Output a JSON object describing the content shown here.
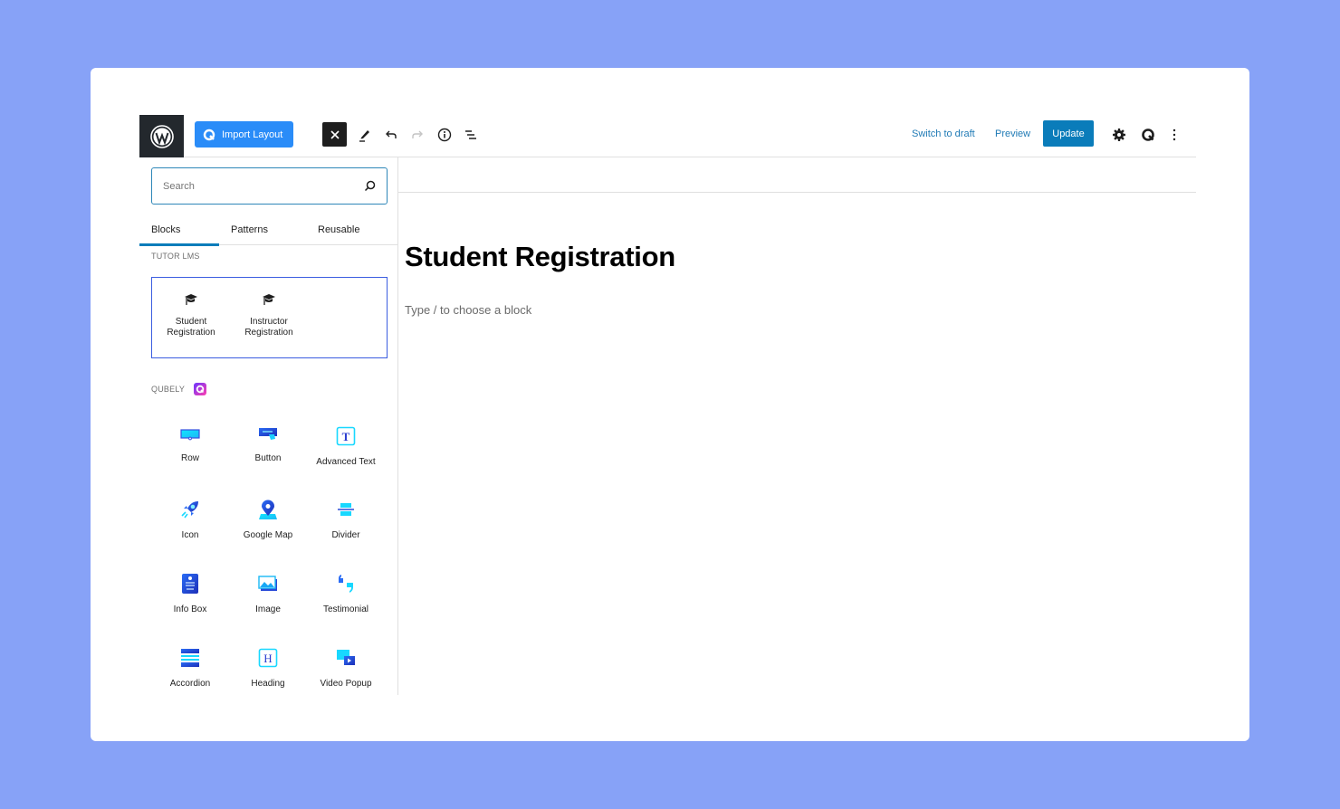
{
  "toolbar": {
    "import_layout_label": "Import Layout",
    "switch_to_draft_label": "Switch to draft",
    "preview_label": "Preview",
    "update_label": "Update",
    "icons": [
      "wordpress-logo",
      "close-icon",
      "pencil-icon",
      "undo-icon",
      "redo-icon",
      "info-icon",
      "list-view-icon",
      "gear-icon",
      "qubely-icon",
      "more-vertical-icon"
    ]
  },
  "sidebar": {
    "search": {
      "placeholder": "Search",
      "value": ""
    },
    "tabs": [
      {
        "label": "Blocks",
        "active": true
      },
      {
        "label": "Patterns",
        "active": false
      },
      {
        "label": "Reusable",
        "active": false
      }
    ],
    "sections": [
      {
        "label": "TUTOR LMS",
        "blocks": [
          {
            "line1": "Student",
            "line2": "Registration",
            "icon": "graduation-cap-icon"
          },
          {
            "line1": "Instructor",
            "line2": "Registration",
            "icon": "graduation-cap-icon"
          }
        ]
      },
      {
        "label": "QUBELY",
        "blocks": [
          {
            "label": "Row",
            "icon": "row-icon"
          },
          {
            "label": "Button",
            "icon": "button-icon"
          },
          {
            "label": "Advanced Text",
            "icon": "advanced-text-icon"
          },
          {
            "label": "Icon",
            "icon": "rocket-icon"
          },
          {
            "label": "Google Map",
            "icon": "map-pin-icon"
          },
          {
            "label": "Divider",
            "icon": "divider-icon"
          },
          {
            "label": "Info Box",
            "icon": "info-box-icon"
          },
          {
            "label": "Image",
            "icon": "image-icon"
          },
          {
            "label": "Testimonial",
            "icon": "quote-icon"
          },
          {
            "label": "Accordion",
            "icon": "accordion-icon"
          },
          {
            "label": "Heading",
            "icon": "heading-icon"
          },
          {
            "label": "Video Popup",
            "icon": "video-popup-icon"
          }
        ]
      }
    ]
  },
  "editor": {
    "title": "Student Registration",
    "block_placeholder": "Type / to choose a block"
  },
  "colors": {
    "background": "#87a2f7",
    "accent": "#0a7cba",
    "import_button": "#2a8cf8",
    "selection_border": "#3b5de0"
  }
}
